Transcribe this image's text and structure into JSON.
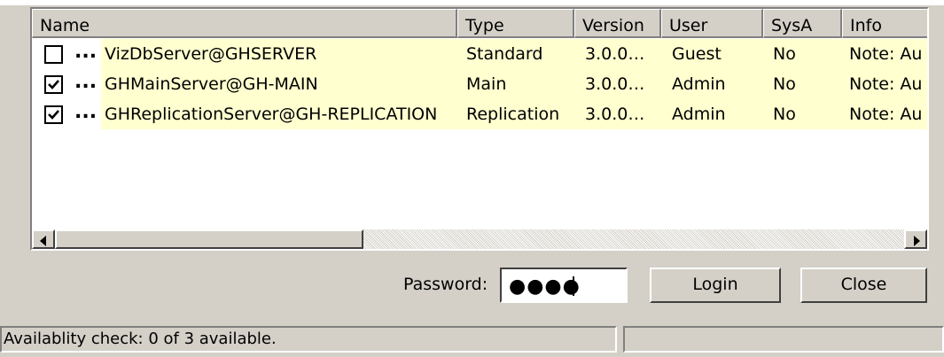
{
  "list": {
    "columns": [
      "Name",
      "Type",
      "Version",
      "User",
      "SysA",
      "Info"
    ],
    "rows": [
      {
        "checked": false,
        "name": "VizDbServer@GHSERVER",
        "type": "Standard",
        "version": "3.0.0…",
        "user": "Guest",
        "sysa": "No",
        "info": "Note: Au"
      },
      {
        "checked": true,
        "name": "GHMainServer@GH-MAIN",
        "type": "Main",
        "version": "3.0.0…",
        "user": "Admin",
        "sysa": "No",
        "info": "Note: Au"
      },
      {
        "checked": true,
        "name": "GHReplicationServer@GH-REPLICATION",
        "type": "Replication",
        "version": "3.0.0…",
        "user": "Admin",
        "sysa": "No",
        "info": "Note: Au"
      }
    ],
    "ellipsis": "..."
  },
  "password": {
    "label": "Password:",
    "masked_value": "●●●●"
  },
  "buttons": {
    "login": "Login",
    "close": "Close"
  },
  "status": {
    "text": "Availablity check: 0 of 3 available.",
    "secondary": ""
  },
  "colors": {
    "window": "#d4d0c8",
    "row_highlight": "#ffffd0"
  }
}
